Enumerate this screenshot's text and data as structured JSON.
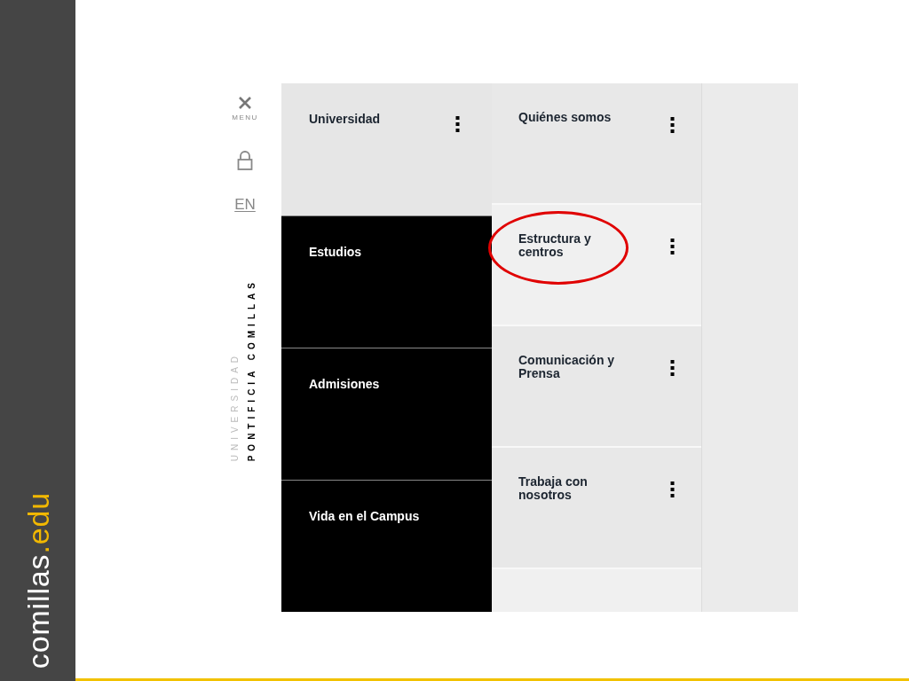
{
  "brand": {
    "name": "comillas",
    "suffix": ".edu"
  },
  "side": {
    "menu_label": "MENU",
    "language": "EN",
    "logo_top": "UNIVERSIDAD",
    "logo_bottom": "PONTIFICIA COMILLAS"
  },
  "main_menu": [
    {
      "label": "Universidad",
      "selected": true
    },
    {
      "label": "Estudios",
      "selected": false
    },
    {
      "label": "Admisiones",
      "selected": false
    },
    {
      "label": "Vida en el Campus",
      "selected": false
    }
  ],
  "submenu": [
    {
      "label": "Quiénes somos",
      "circled": false
    },
    {
      "label": "Estructura y centros",
      "circled": true
    },
    {
      "label": "Comunicación y Prensa",
      "circled": false
    },
    {
      "label": "Trabaja con nosotros",
      "circled": false
    }
  ]
}
